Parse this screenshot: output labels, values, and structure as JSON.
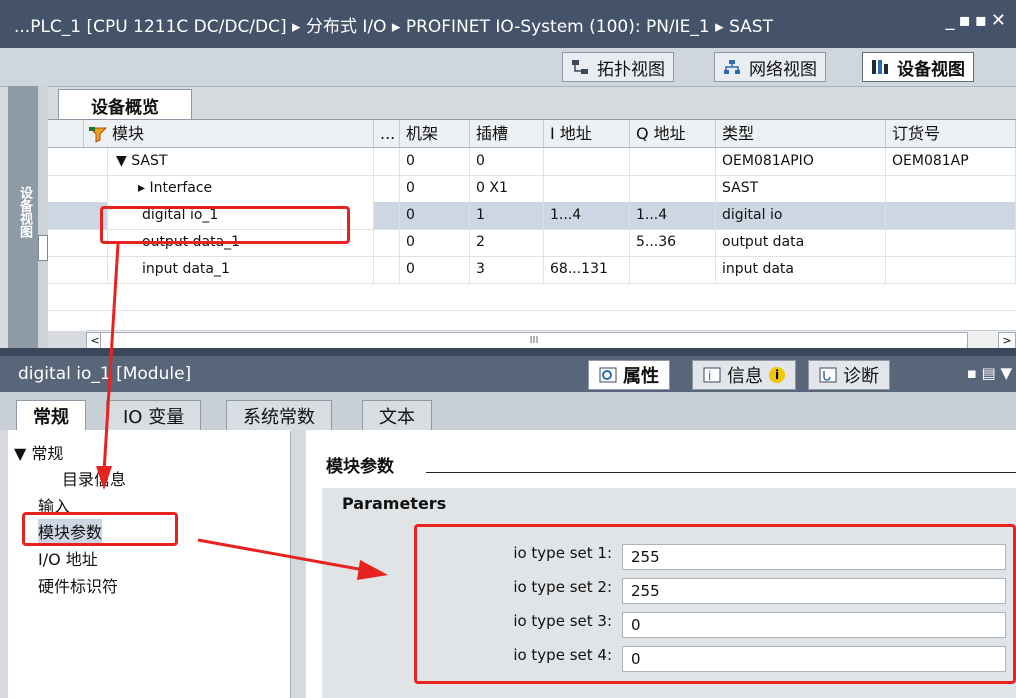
{
  "titlebar": {
    "title": "...PLC_1 [CPU 1211C DC/DC/DC] ▸ 分布式 I/O ▸ PROFINET IO-System (100): PN/IE_1 ▸ SAST",
    "controls": "_▪▪✕"
  },
  "view_tabs": [
    {
      "label": "拓扑视图",
      "icon": "topology-icon"
    },
    {
      "label": "网络视图",
      "icon": "network-icon"
    },
    {
      "label": "设备视图",
      "icon": "device-icon"
    }
  ],
  "side_strip_label": "设备视图",
  "overview": {
    "tab_label": "设备概览",
    "columns": [
      "模块",
      "...",
      "机架",
      "插槽",
      "I 地址",
      "Q 地址",
      "类型",
      "订货号"
    ],
    "rows": [
      {
        "module": "▼ SAST",
        "rack": "0",
        "slot": "0",
        "i_addr": "",
        "q_addr": "",
        "type": "OEM081APIO",
        "order": "OEM081AP"
      },
      {
        "module": "▸ Interface",
        "rack": "0",
        "slot": "0 X1",
        "i_addr": "",
        "q_addr": "",
        "type": "SAST",
        "order": ""
      },
      {
        "module": "digital io_1",
        "rack": "0",
        "slot": "1",
        "i_addr": "1...4",
        "q_addr": "1...4",
        "type": "digital io",
        "order": ""
      },
      {
        "module": "output data_1",
        "rack": "0",
        "slot": "2",
        "i_addr": "",
        "q_addr": "5...36",
        "type": "output data",
        "order": ""
      },
      {
        "module": "input data_1",
        "rack": "0",
        "slot": "3",
        "i_addr": "68...131",
        "q_addr": "",
        "type": "input data",
        "order": ""
      }
    ],
    "scroll_thumb": "III"
  },
  "inspector": {
    "title": "digital io_1 [Module]",
    "tabs": [
      {
        "label": "属性",
        "icon": "properties-icon"
      },
      {
        "label": "信息",
        "icon": "info-icon"
      },
      {
        "label": "诊断",
        "icon": "diagnostics-icon"
      }
    ],
    "subtabs": [
      "常规",
      "IO 变量",
      "系统常数",
      "文本"
    ],
    "nav": [
      "▼ 常规",
      "目录信息",
      "输入",
      "模块参数",
      "I/O 地址",
      "硬件标识符"
    ],
    "section_title": "模块参数",
    "param_group": "Parameters",
    "params": [
      {
        "label": "io type set 1:",
        "value": "255"
      },
      {
        "label": "io type set 2:",
        "value": "255"
      },
      {
        "label": "io type set 3:",
        "value": "0"
      },
      {
        "label": "io type set 4:",
        "value": "0"
      }
    ]
  },
  "colors": {
    "annotation": "#e8231f",
    "titlebar": "#44526a"
  }
}
